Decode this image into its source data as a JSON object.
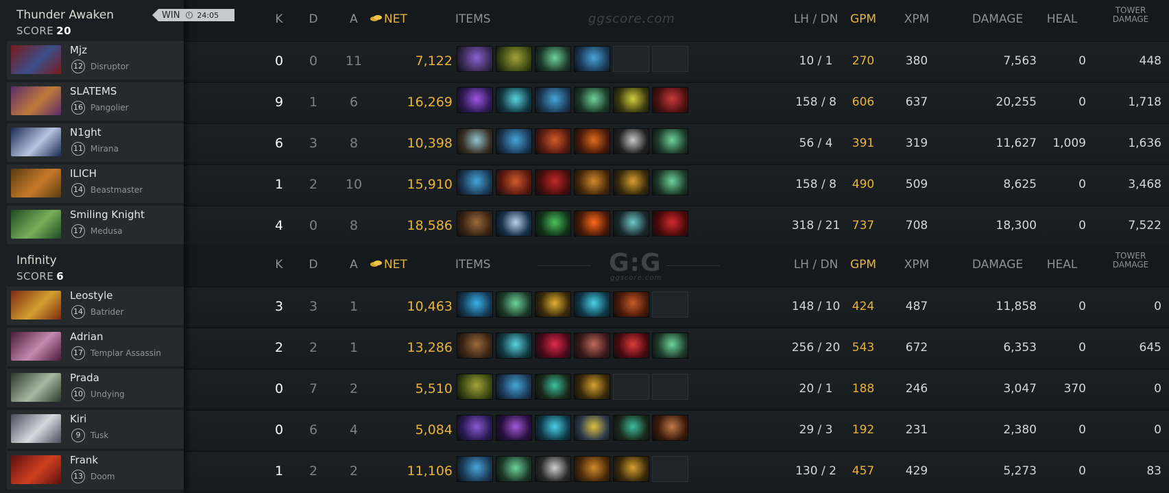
{
  "teams": [
    {
      "name": "Thunder Awaken",
      "score_label": "SCORE",
      "score": "20",
      "result": "WIN",
      "duration": "24:05",
      "players": [
        {
          "name": "Mjz",
          "level": "12",
          "hero": "Disruptor",
          "k": "0",
          "d": "0",
          "a": "11",
          "net": "7,122",
          "lh_dn": "10  /  1",
          "gpm": "270",
          "xpm": "380",
          "damage": "7,563",
          "heal": "0",
          "tower": "448",
          "portrait": [
            "#7a1a1a",
            "#3b4f8a"
          ],
          "items": [
            [
              "#3a2a55",
              "#8a5fd0"
            ],
            [
              "#3d4a12",
              "#a3a23a"
            ],
            [
              "#1d3a2a",
              "#6dd49a"
            ],
            [
              "#1c3a58",
              "#46a6d8"
            ],
            null,
            null
          ]
        },
        {
          "name": "SLATEMS",
          "level": "16",
          "hero": "Pangolier",
          "k": "9",
          "d": "1",
          "a": "6",
          "net": "16,269",
          "lh_dn": "158  /  8",
          "gpm": "606",
          "xpm": "637",
          "damage": "20,255",
          "heal": "0",
          "tower": "1,718",
          "portrait": [
            "#5a2a6a",
            "#c07b3a"
          ],
          "items": [
            [
              "#2e1a55",
              "#9f55e0"
            ],
            [
              "#133b44",
              "#59d3e0"
            ],
            [
              "#1c3a58",
              "#46a6d8"
            ],
            [
              "#1d3a2a",
              "#6dd49a"
            ],
            [
              "#3b3a10",
              "#d1cd3c"
            ],
            [
              "#4d1010",
              "#c83a3a"
            ]
          ]
        },
        {
          "name": "N1ght",
          "level": "11",
          "hero": "Mirana",
          "k": "6",
          "d": "3",
          "a": "8",
          "net": "10,398",
          "lh_dn": "56  /  4",
          "gpm": "391",
          "xpm": "319",
          "damage": "11,627",
          "heal": "1,009",
          "tower": "1,636",
          "portrait": [
            "#1b2a55",
            "#b6c4de"
          ],
          "items": [
            [
              "#3a2f22",
              "#8fc3d0"
            ],
            [
              "#1c3a58",
              "#46a6d8"
            ],
            [
              "#5a1a10",
              "#d05a2a"
            ],
            [
              "#4a1a0a",
              "#e06a1a"
            ],
            [
              "#222",
              "#c9c9c9"
            ],
            [
              "#1d3a2a",
              "#6dd49a"
            ]
          ]
        },
        {
          "name": "ILICH",
          "level": "14",
          "hero": "Beastmaster",
          "k": "1",
          "d": "2",
          "a": "10",
          "net": "15,910",
          "lh_dn": "158  /  8",
          "gpm": "490",
          "xpm": "509",
          "damage": "8,625",
          "heal": "0",
          "tower": "3,468",
          "portrait": [
            "#5a3a10",
            "#c77a2a"
          ],
          "items": [
            [
              "#1c3a58",
              "#46a6d8"
            ],
            [
              "#5a1a10",
              "#d05a2a"
            ],
            [
              "#4a0d0d",
              "#c02828"
            ],
            [
              "#4a2a0a",
              "#d08a2a"
            ],
            [
              "#3a2a0a",
              "#d6a030"
            ],
            [
              "#1d3a2a",
              "#6dd49a"
            ]
          ]
        },
        {
          "name": "Smiling Knight",
          "level": "17",
          "hero": "Medusa",
          "k": "4",
          "d": "0",
          "a": "8",
          "net": "18,586",
          "lh_dn": "318  /  21",
          "gpm": "737",
          "xpm": "708",
          "damage": "18,300",
          "heal": "0",
          "tower": "7,522",
          "portrait": [
            "#1e4a22",
            "#79b05a"
          ],
          "items": [
            [
              "#3a2414",
              "#9a6a3a"
            ],
            [
              "#16304a",
              "#b8d2ea"
            ],
            [
              "#12351a",
              "#4ac05a"
            ],
            [
              "#4a1a08",
              "#ff6a1a"
            ],
            [
              "#1a2a2e",
              "#6fc8c8"
            ],
            [
              "#4a0a0a",
              "#d02a2a"
            ]
          ]
        }
      ]
    },
    {
      "name": "Infinity",
      "score_label": "SCORE",
      "score": "6",
      "players": [
        {
          "name": "Leostyle",
          "level": "14",
          "hero": "Batrider",
          "k": "3",
          "d": "3",
          "a": "1",
          "net": "10,463",
          "lh_dn": "148  /  10",
          "gpm": "424",
          "xpm": "487",
          "damage": "11,858",
          "heal": "0",
          "tower": "0",
          "portrait": [
            "#7a2a10",
            "#d4a030"
          ],
          "items": [
            [
              "#143a55",
              "#3ab0e8"
            ],
            [
              "#1d3a2a",
              "#6dd49a"
            ],
            [
              "#3a2a0a",
              "#e0b030"
            ],
            [
              "#0f3a4a",
              "#4ad0e8"
            ],
            [
              "#4a1a08",
              "#c85a2a"
            ],
            null
          ]
        },
        {
          "name": "Adrian",
          "level": "17",
          "hero": "Templar Assassin",
          "k": "2",
          "d": "2",
          "a": "1",
          "net": "13,286",
          "lh_dn": "256  /  20",
          "gpm": "543",
          "xpm": "672",
          "damage": "6,353",
          "heal": "0",
          "tower": "645",
          "portrait": [
            "#4a1a3a",
            "#c58ab0"
          ],
          "items": [
            [
              "#3a2414",
              "#9a6a3a"
            ],
            [
              "#133b44",
              "#59d3e0"
            ],
            [
              "#4a0a1a",
              "#e02a4a"
            ],
            [
              "#3a1a1a",
              "#c06a5a"
            ],
            [
              "#4a0a10",
              "#e03a3a"
            ],
            [
              "#1d3a2a",
              "#6dd49a"
            ]
          ]
        },
        {
          "name": "Prada",
          "level": "10",
          "hero": "Undying",
          "k": "0",
          "d": "7",
          "a": "2",
          "net": "5,510",
          "lh_dn": "20  /  1",
          "gpm": "188",
          "xpm": "246",
          "damage": "3,047",
          "heal": "370",
          "tower": "0",
          "portrait": [
            "#2a3a2a",
            "#a8b8a0"
          ],
          "items": [
            [
              "#3d4a12",
              "#a3a23a"
            ],
            [
              "#1c3a58",
              "#46a6d8"
            ],
            [
              "#1a2a1a",
              "#3ac0a0"
            ],
            [
              "#3a2a0a",
              "#d6a030"
            ],
            null,
            null
          ]
        },
        {
          "name": "Kiri",
          "level": "9",
          "hero": "Tusk",
          "k": "0",
          "d": "6",
          "a": "4",
          "net": "5,084",
          "lh_dn": "29  /  3",
          "gpm": "192",
          "xpm": "231",
          "damage": "2,380",
          "heal": "0",
          "tower": "0",
          "portrait": [
            "#4a4a5a",
            "#d8d8e0"
          ],
          "items": [
            [
              "#2a1a55",
              "#8a5ad0"
            ],
            [
              "#2a1040",
              "#a05ad8"
            ],
            [
              "#0f3a4a",
              "#4ad0e8"
            ],
            [
              "#2a3a4a",
              "#e0c040"
            ],
            [
              "#1a2a1a",
              "#3ac0a0"
            ],
            [
              "#3a1a0a",
              "#c07a4a"
            ]
          ]
        },
        {
          "name": "Frank",
          "level": "13",
          "hero": "Doom",
          "k": "1",
          "d": "2",
          "a": "2",
          "net": "11,106",
          "lh_dn": "130  /  2",
          "gpm": "457",
          "xpm": "429",
          "damage": "5,273",
          "heal": "0",
          "tower": "83",
          "portrait": [
            "#5a1010",
            "#d04020"
          ],
          "items": [
            [
              "#1c3a58",
              "#46a6d8"
            ],
            [
              "#1d3a2a",
              "#6dd49a"
            ],
            [
              "#2a2a2a",
              "#d0d0d0"
            ],
            [
              "#4a2a0a",
              "#d08a2a"
            ],
            [
              "#3a2a0a",
              "#d6a030"
            ],
            null
          ]
        }
      ]
    }
  ],
  "columns": {
    "k": "K",
    "d": "D",
    "a": "A",
    "net": "NET",
    "items": "ITEMS",
    "lh_dn": "LH  /  DN",
    "gpm": "GPM",
    "xpm": "XPM",
    "damage": "DAMAGE",
    "heal": "HEAL",
    "tower": "TOWER\nDAMAGE"
  },
  "watermark": "ggscore.com",
  "logo": "G:G",
  "logo_sub": "ggscore.com",
  "colors": {
    "gold": "#e8b33a",
    "background": "#15191c",
    "sidebar": "#1b1f22"
  },
  "icons": {
    "clock": "clock-icon",
    "coin": "gold-coin-icon"
  }
}
